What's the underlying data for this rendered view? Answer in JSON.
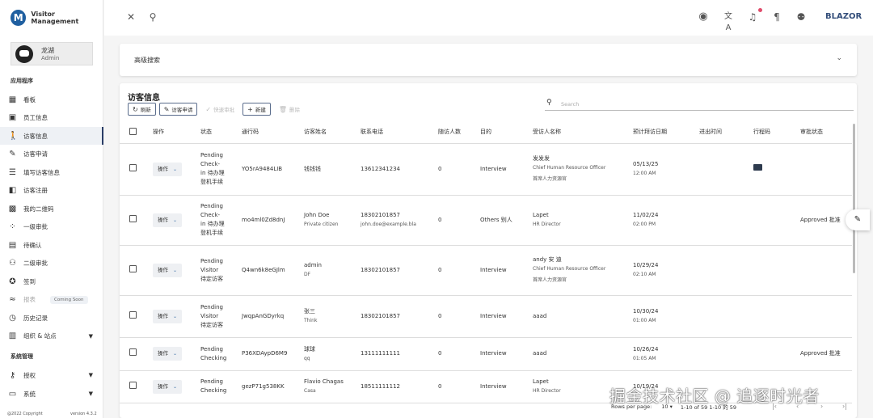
{
  "app": {
    "title": "Visitor Management",
    "logo_letter": "M",
    "brand_right": "BLAZOR"
  },
  "user": {
    "name": "龙湖",
    "role": "Admin"
  },
  "sidebar": {
    "section1": "应用程序",
    "section2": "系统管理",
    "items": [
      {
        "label": "看板",
        "icon": "dashboard-icon",
        "glyph": "▦"
      },
      {
        "label": "员工信息",
        "icon": "badge-icon",
        "glyph": "▣"
      },
      {
        "label": "访客信息",
        "icon": "walk-icon",
        "glyph": "🚶"
      },
      {
        "label": "访客申请",
        "icon": "add-note-icon",
        "glyph": "✎"
      },
      {
        "label": "填写访客信息",
        "icon": "edit-list-icon",
        "glyph": "☰"
      },
      {
        "label": "访客注册",
        "icon": "bookmark-icon",
        "glyph": "◧"
      },
      {
        "label": "我的二维码",
        "icon": "qr-code-icon",
        "glyph": "▩"
      },
      {
        "label": "一级审批",
        "icon": "approval-icon",
        "glyph": "⁘"
      },
      {
        "label": "待确认",
        "icon": "pending-icon",
        "glyph": "▤"
      },
      {
        "label": "二级审批",
        "icon": "people-icon",
        "glyph": "⚇"
      },
      {
        "label": "签到",
        "icon": "checkin-icon",
        "glyph": "✪"
      },
      {
        "label": "报表",
        "icon": "chart-icon",
        "glyph": "≈",
        "badge": "Coming Soon"
      },
      {
        "label": "历史记录",
        "icon": "history-icon",
        "glyph": "◷"
      },
      {
        "label": "组织 & 站点",
        "icon": "building-icon",
        "glyph": "▥"
      }
    ],
    "items2": [
      {
        "label": "授权",
        "icon": "key-icon",
        "glyph": "⚷"
      },
      {
        "label": "系统",
        "icon": "computer-icon",
        "glyph": "▭"
      }
    ],
    "footer_left": "@2022 Copyright",
    "footer_right": "version 4.3.2"
  },
  "adv_search": {
    "label": "高级搜索"
  },
  "panel": {
    "title": "访客信息",
    "toolbar": [
      {
        "label": "刷新",
        "glyph": "↻"
      },
      {
        "label": "访客申请",
        "glyph": "✎"
      },
      {
        "label": "快速审批",
        "glyph": "✓"
      },
      {
        "label": "新建",
        "glyph": "+"
      },
      {
        "label": "删除",
        "glyph": "🗑"
      }
    ],
    "search_placeholder": "Search"
  },
  "table": {
    "headers": [
      "操作",
      "状态",
      "通行码",
      "访客姓名",
      "联系电话",
      "随访人数",
      "目的",
      "受访人名称",
      "预计拜访日期",
      "进出时间",
      "行程码",
      "审批状态"
    ],
    "op_label": "操作",
    "rows": [
      {
        "status": [
          "Pending",
          "Check-",
          "in 待办理",
          "登机手续"
        ],
        "code": "YO5rA9484LIB",
        "name": "钱钱钱",
        "name_sub": "",
        "phone": "13612341234",
        "phone_sub": "",
        "count": "0",
        "purpose": "Interview",
        "host": "发发发",
        "host_sub": "Chief Human Resource Officer",
        "host_sub2": "首席人力资源官",
        "date": "05/13/25",
        "time": "12:00 AM",
        "qr": true,
        "approval": ""
      },
      {
        "status": [
          "Pending",
          "Check-",
          "in 待办理",
          "登机手续"
        ],
        "code": "mo4ml0Zd8dnJ",
        "name": "John Doe",
        "name_sub": "Private citizen",
        "phone": "18302101857",
        "phone_sub": "john.doe@example.bla",
        "count": "0",
        "purpose": "Others 别人",
        "host": "Lapet",
        "host_sub": "HR Director",
        "host_sub2": "",
        "date": "11/02/24",
        "time": "02:00 PM",
        "qr": false,
        "approval": "Approved 批准"
      },
      {
        "status": [
          "Pending",
          "Visitor",
          "待定访客"
        ],
        "code": "Q4wn6k8eGJlm",
        "name": "admin",
        "name_sub": "DF",
        "phone": "18302101857",
        "phone_sub": "",
        "count": "0",
        "purpose": "Interview",
        "host": "andy 安 迪",
        "host_sub": "Chief Human Resource Officer",
        "host_sub2": "首席人力资源官",
        "date": "10/29/24",
        "time": "02:10 AM",
        "qr": false,
        "approval": ""
      },
      {
        "status": [
          "Pending",
          "Visitor",
          "待定访客"
        ],
        "code": "JwqpAnGDyrkq",
        "name": "张三",
        "name_sub": "Think",
        "phone": "18302101857",
        "phone_sub": "",
        "count": "0",
        "purpose": "Interview",
        "host": "aaad",
        "host_sub": "",
        "host_sub2": "",
        "date": "10/30/24",
        "time": "01:00 AM",
        "qr": false,
        "approval": ""
      },
      {
        "status": [
          "Pending",
          "Checking"
        ],
        "code": "P36XDAypD6M9",
        "name": "球球",
        "name_sub": "qq",
        "phone": "13111111111",
        "phone_sub": "",
        "count": "0",
        "purpose": "Interview",
        "host": "aaad",
        "host_sub": "",
        "host_sub2": "",
        "date": "10/26/24",
        "time": "01:05 AM",
        "qr": false,
        "approval": "Approved 批准"
      },
      {
        "status": [
          "Pending",
          "Checking"
        ],
        "code": "gezP71g538KK",
        "name": "Flavio Chagas",
        "name_sub": "Casa",
        "phone": "18511111112",
        "phone_sub": "",
        "count": "0",
        "purpose": "Interview",
        "host": "Lapet",
        "host_sub": "HR Director",
        "host_sub2": "",
        "date": "10/19/24",
        "time": "",
        "qr": false,
        "approval": ""
      }
    ]
  },
  "pagination": {
    "rows_per_page_label": "Rows per page:",
    "rows_per_page": "10",
    "range": "1-10 of 59 1-10 的 59"
  },
  "watermark": "掘金技术社区 @ 追逐时光者",
  "colors": {
    "accent": "#2a3d66",
    "brand": "#334e7a",
    "notification": "#e04c6b"
  }
}
